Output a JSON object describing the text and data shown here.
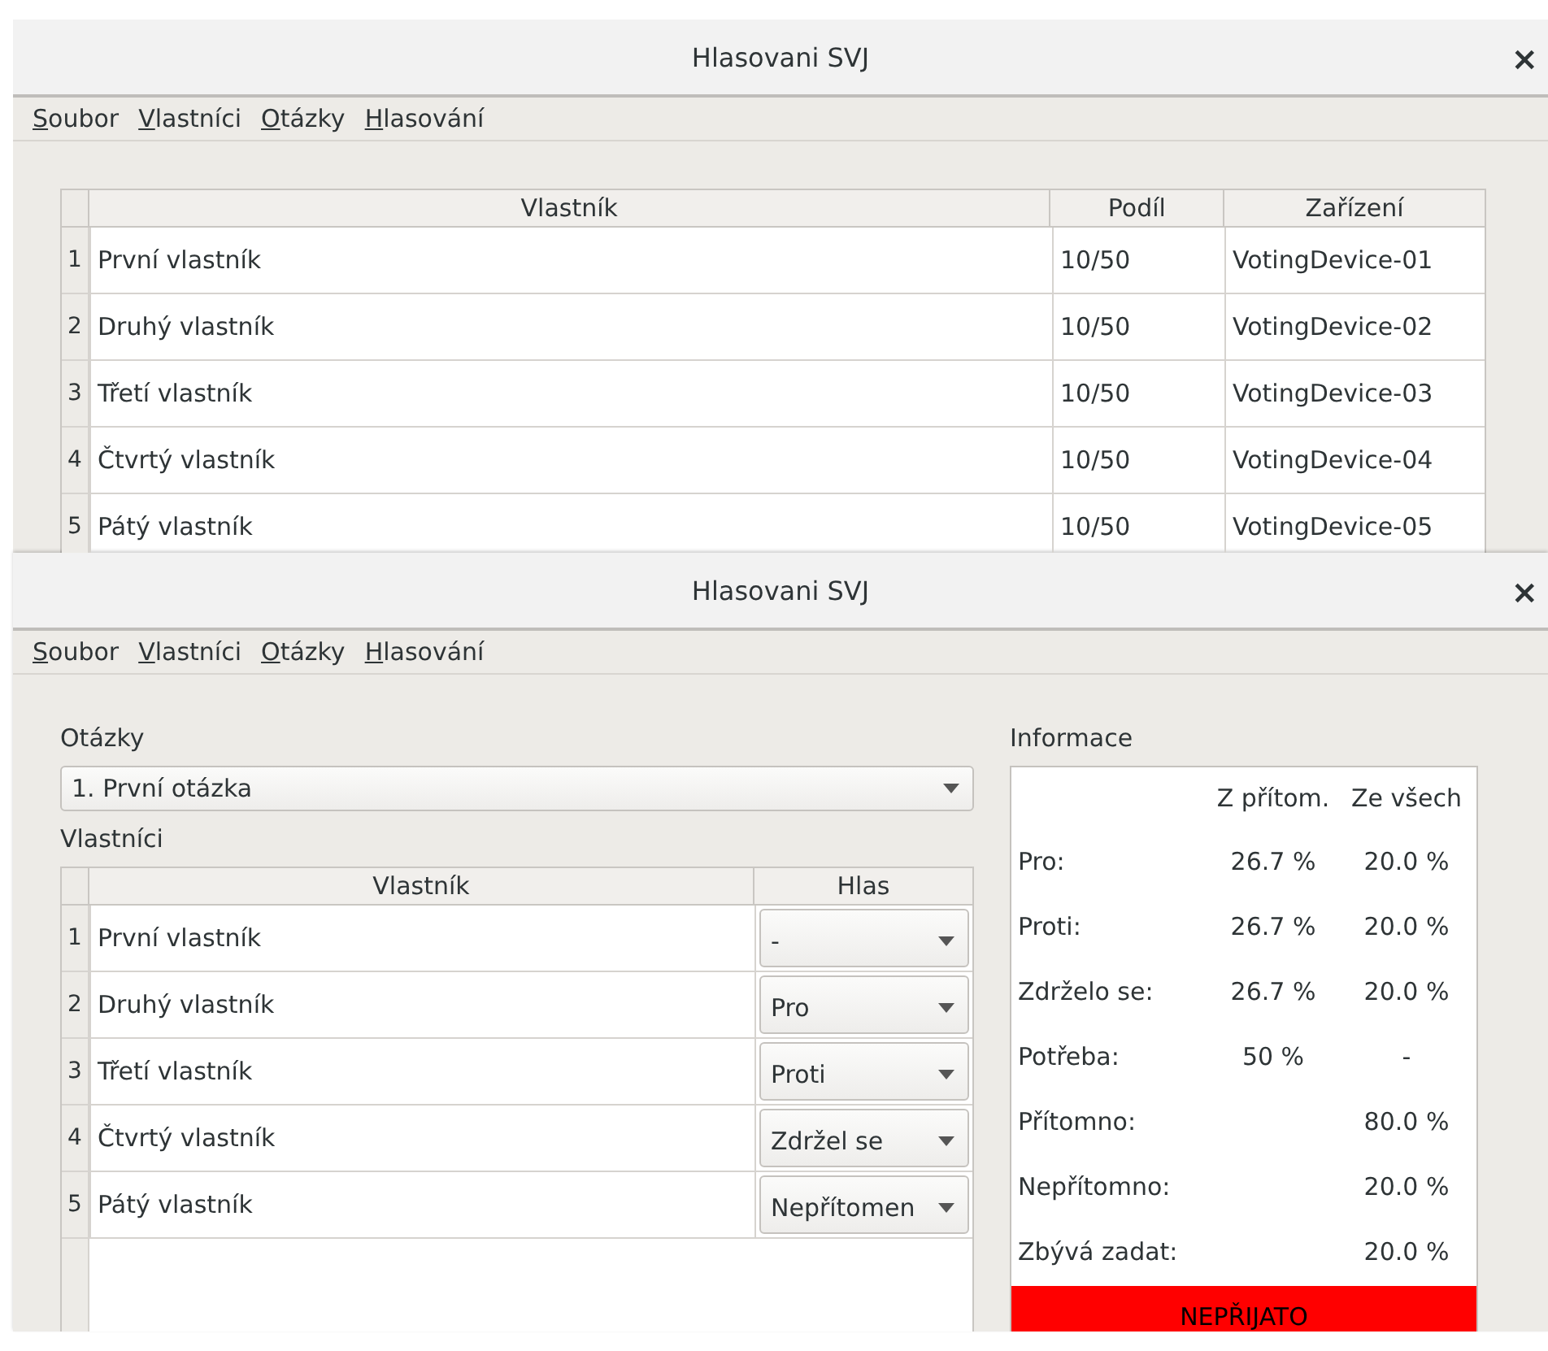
{
  "owners_window": {
    "title": "Hlasovani SVJ",
    "close": "×",
    "menu": [
      "Soubor",
      "Vlastníci",
      "Otázky",
      "Hlasování"
    ],
    "table": {
      "columns": [
        "Vlastník",
        "Podíl",
        "Zařízení"
      ],
      "rows": [
        {
          "number": "1",
          "owner": "První vlastník",
          "share": "10/50",
          "device": "VotingDevice-01"
        },
        {
          "number": "2",
          "owner": "Druhý vlastník",
          "share": "10/50",
          "device": "VotingDevice-02"
        },
        {
          "number": "3",
          "owner": "Třetí vlastník",
          "share": "10/50",
          "device": "VotingDevice-03"
        },
        {
          "number": "4",
          "owner": "Čtvrtý vlastník",
          "share": "10/50",
          "device": "VotingDevice-04"
        },
        {
          "number": "5",
          "owner": "Pátý vlastník",
          "share": "10/50",
          "device": "VotingDevice-05"
        }
      ]
    }
  },
  "voting_window": {
    "title": "Hlasovani SVJ",
    "close": "×",
    "menu": [
      "Soubor",
      "Vlastníci",
      "Otázky",
      "Hlasování"
    ],
    "questions_label": "Otázky",
    "question_select": "1. První otázka",
    "owners_label": "Vlastníci",
    "table": {
      "columns": [
        "Vlastník",
        "Hlas"
      ],
      "rows": [
        {
          "number": "1",
          "owner": "První vlastník",
          "vote": "-"
        },
        {
          "number": "2",
          "owner": "Druhý vlastník",
          "vote": "Pro"
        },
        {
          "number": "3",
          "owner": "Třetí vlastník",
          "vote": "Proti"
        },
        {
          "number": "4",
          "owner": "Čtvrtý vlastník",
          "vote": "Zdržel se"
        },
        {
          "number": "5",
          "owner": "Pátý vlastník",
          "vote": "Nepřítomen"
        }
      ]
    },
    "info": {
      "title": "Informace",
      "columns": [
        "Z přítom.",
        "Ze všech"
      ],
      "rows": [
        {
          "label": "Pro:",
          "present": "26.7 %",
          "all": "20.0 %"
        },
        {
          "label": "Proti:",
          "present": "26.7 %",
          "all": "20.0 %"
        },
        {
          "label": "Zdrželo se:",
          "present": "26.7 %",
          "all": "20.0 %"
        },
        {
          "label": "Potřeba:",
          "present": "50 %",
          "all": "-"
        },
        {
          "label": "Přítomno:",
          "all": "80.0 %"
        },
        {
          "label": "Nepřítomno:",
          "all": "20.0 %"
        },
        {
          "label": "Zbývá zadat:",
          "all": "20.0 %"
        }
      ],
      "result": {
        "text": "NEPŘIJATO",
        "accepted": false
      }
    }
  }
}
